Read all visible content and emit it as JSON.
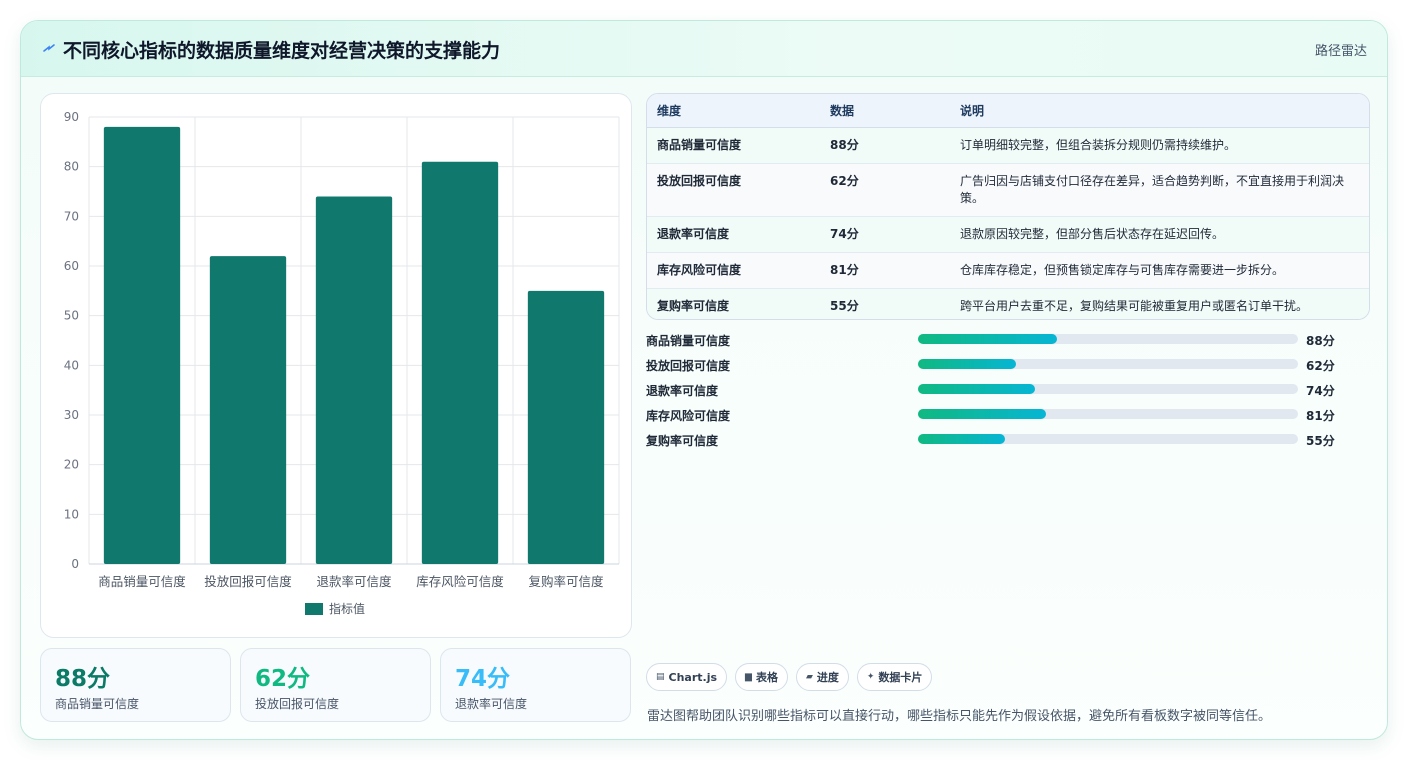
{
  "header": {
    "title": "不同核心指标的数据质量维度对经营决策的支撑能力",
    "mode_label": "路径雷达",
    "icon": "bolt-icon"
  },
  "colors": {
    "bar": "#10786d",
    "accent_green": "#10b981",
    "accent_cyan": "#06b6d4",
    "stat1": "#0b7a66",
    "stat2": "#10b981",
    "stat3": "#38bdf8"
  },
  "chart_data": {
    "type": "bar",
    "categories": [
      "商品销量可信度",
      "投放回报可信度",
      "退款率可信度",
      "库存风险可信度",
      "复购率可信度"
    ],
    "series": [
      {
        "name": "指标值",
        "values": [
          88,
          62,
          74,
          81,
          55
        ]
      }
    ],
    "ylim": [
      0,
      90
    ],
    "yticks": [
      0,
      10,
      20,
      30,
      40,
      50,
      60,
      70,
      80,
      90
    ],
    "grid": true,
    "legend": "bottom"
  },
  "stats": [
    {
      "value": "88分",
      "label": "商品销量可信度"
    },
    {
      "value": "62分",
      "label": "投放回报可信度"
    },
    {
      "value": "74分",
      "label": "退款率可信度"
    }
  ],
  "table": {
    "headers": [
      "维度",
      "数据",
      "说明"
    ],
    "rows": [
      {
        "dim": "商品销量可信度",
        "data": "88分",
        "desc": "订单明细较完整，但组合装拆分规则仍需持续维护。"
      },
      {
        "dim": "投放回报可信度",
        "data": "62分",
        "desc": "广告归因与店铺支付口径存在差异，适合趋势判断，不宜直接用于利润决策。"
      },
      {
        "dim": "退款率可信度",
        "data": "74分",
        "desc": "退款原因较完整，但部分售后状态存在延迟回传。"
      },
      {
        "dim": "库存风险可信度",
        "data": "81分",
        "desc": "仓库库存稳定，但预售锁定库存与可售库存需要进一步拆分。"
      },
      {
        "dim": "复购率可信度",
        "data": "55分",
        "desc": "跨平台用户去重不足，复购结果可能被重复用户或匿名订单干扰。"
      }
    ]
  },
  "progress": [
    {
      "label": "商品销量可信度",
      "value": 88,
      "text": "88分"
    },
    {
      "label": "投放回报可信度",
      "value": 62,
      "text": "62分"
    },
    {
      "label": "退款率可信度",
      "value": 74,
      "text": "74分"
    },
    {
      "label": "库存风险可信度",
      "value": 81,
      "text": "81分"
    },
    {
      "label": "复购率可信度",
      "value": 55,
      "text": "55分"
    }
  ],
  "chips": [
    {
      "icon": "chart-icon",
      "glyph": "▤",
      "label": "Chart.js"
    },
    {
      "icon": "table-icon",
      "glyph": "▆",
      "label": "表格"
    },
    {
      "icon": "progress-icon",
      "glyph": "▰",
      "label": "进度"
    },
    {
      "icon": "card-icon",
      "glyph": "✦",
      "label": "数据卡片"
    }
  ],
  "footer": "雷达图帮助团队识别哪些指标可以直接行动，哪些指标只能先作为假设依据，避免所有看板数字被同等信任。"
}
